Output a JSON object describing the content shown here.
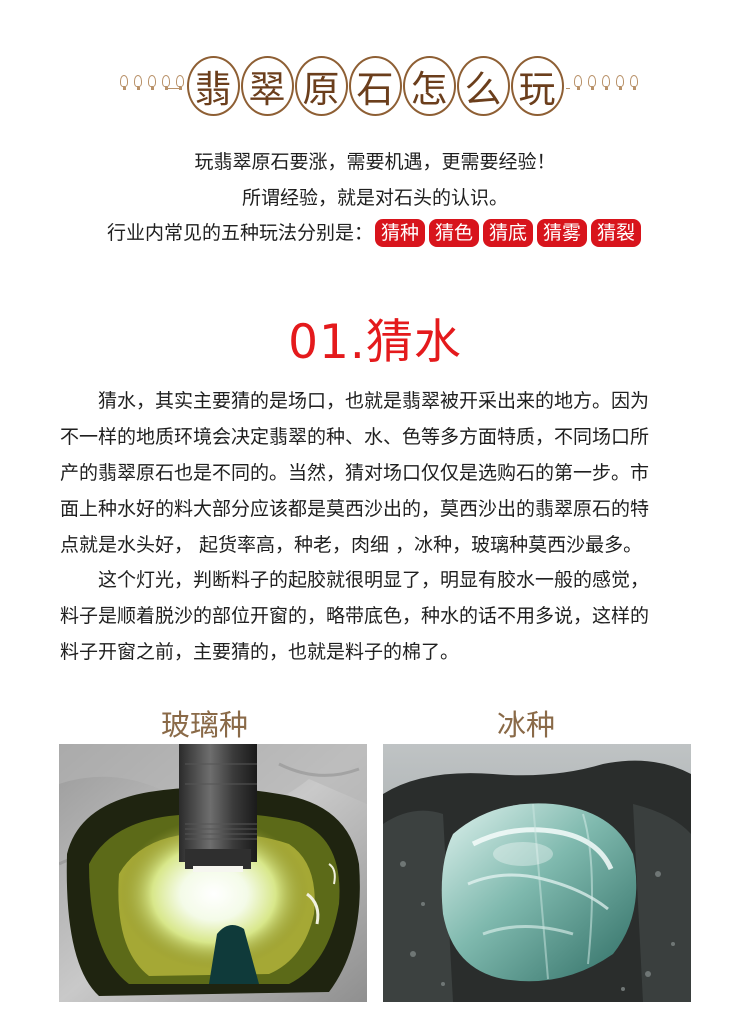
{
  "title": {
    "chars": [
      "翡",
      "翠",
      "原",
      "石",
      "怎",
      "么",
      "玩"
    ]
  },
  "intro": {
    "line1": "玩翡翠原石要涨，需要机遇，更需要经验！",
    "line2": "所谓经验，就是对石头的认识。",
    "line3_prefix": "行业内常见的五种玩法分别是：",
    "tags": [
      "猜种",
      "猜色",
      "猜底",
      "猜雾",
      "猜裂"
    ]
  },
  "section": {
    "heading": "01.猜水",
    "paragraph1_lines": [
      "　　猜水，其实主要猜的是场口，也就是翡翠被开采出来的地方。因为",
      "不一样的地质环境会决定翡翠的种、水、色等多方面特质，不同场口所",
      "产的翡翠原石也是不同的。当然，猜对场口仅仅是选购石的第一步。市",
      "面上种水好的料大部分应该都是莫西沙出的，莫西沙出的翡翠原石的特",
      "点就是水头好， 起货率高，种老，肉细 ，冰种，玻璃种莫西沙最多。"
    ],
    "paragraph2_lines": [
      "　　这个灯光，判断料子的起胶就很明显了，明显有胶水一般的感觉，",
      "料子是顺着脱沙的部位开窗的，略带底色，种水的话不用多说，这样的",
      "料子开窗之前，主要猜的，也就是料子的棉了。"
    ]
  },
  "images": {
    "left_caption": "玻璃种",
    "right_caption": "冰种"
  },
  "colors": {
    "accent_red": "#e41a1c",
    "tag_red": "#d8141c",
    "title_brown": "#6b3e1c",
    "caption_brown": "#8a6a48"
  }
}
